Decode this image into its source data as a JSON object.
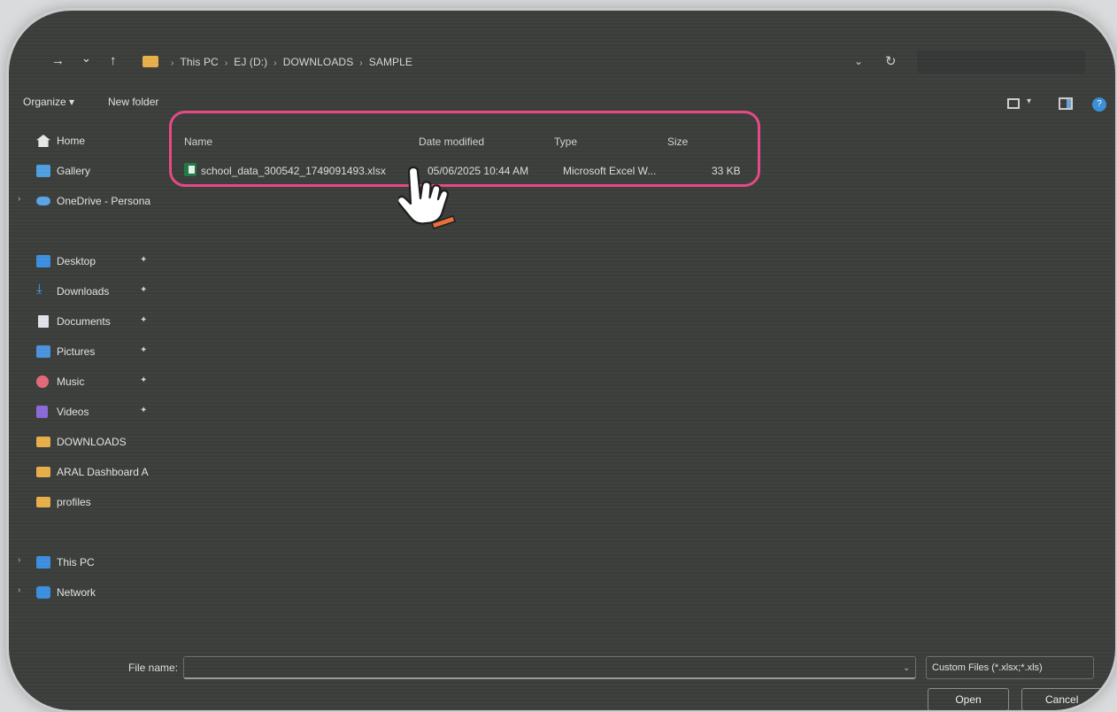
{
  "address_bar": {
    "nav": {
      "forward": "→",
      "recent": "⌄",
      "up": "↑"
    },
    "breadcrumb": [
      "This PC",
      "EJ (D:)",
      "DOWNLOADS",
      "SAMPLE"
    ],
    "dropdown": "⌄",
    "refresh": "↻"
  },
  "toolbar": {
    "organize_label": "Organize ▾",
    "new_folder_label": "New folder",
    "help": "?"
  },
  "sidebar": {
    "items": [
      {
        "label": "Home",
        "icon": "home-icon"
      },
      {
        "label": "Gallery",
        "icon": "gallery-icon"
      },
      {
        "label": "OneDrive - Persona",
        "icon": "cloud-icon"
      },
      {
        "label": "Desktop",
        "icon": "desktop-icon"
      },
      {
        "label": "Downloads",
        "icon": "download-icon"
      },
      {
        "label": "Documents",
        "icon": "document-icon"
      },
      {
        "label": "Pictures",
        "icon": "pictures-icon"
      },
      {
        "label": "Music",
        "icon": "music-icon"
      },
      {
        "label": "Videos",
        "icon": "videos-icon"
      },
      {
        "label": "DOWNLOADS",
        "icon": "folder-icon"
      },
      {
        "label": "ARAL Dashboard A",
        "icon": "folder-icon"
      },
      {
        "label": "profiles",
        "icon": "folder-icon"
      },
      {
        "label": "This PC",
        "icon": "pc-icon"
      },
      {
        "label": "Network",
        "icon": "network-icon"
      }
    ]
  },
  "file_list": {
    "columns": [
      "Name",
      "Date modified",
      "Type",
      "Size"
    ],
    "rows": [
      {
        "name": "school_data_300542_1749091493.xlsx",
        "date_modified": "05/06/2025 10:44 AM",
        "type": "Microsoft Excel W...",
        "size": "33 KB",
        "icon": "excel-file-icon"
      }
    ]
  },
  "footer": {
    "file_name_label": "File name:",
    "file_name_value": "",
    "file_type_filter": "Custom Files (*.xlsx;*.xls)",
    "open_button": "Open",
    "cancel_button": "Cancel"
  },
  "colors": {
    "highlight": "#e64a86",
    "window_bg": "#3b3e3b",
    "accent": "#3d8fe0"
  }
}
